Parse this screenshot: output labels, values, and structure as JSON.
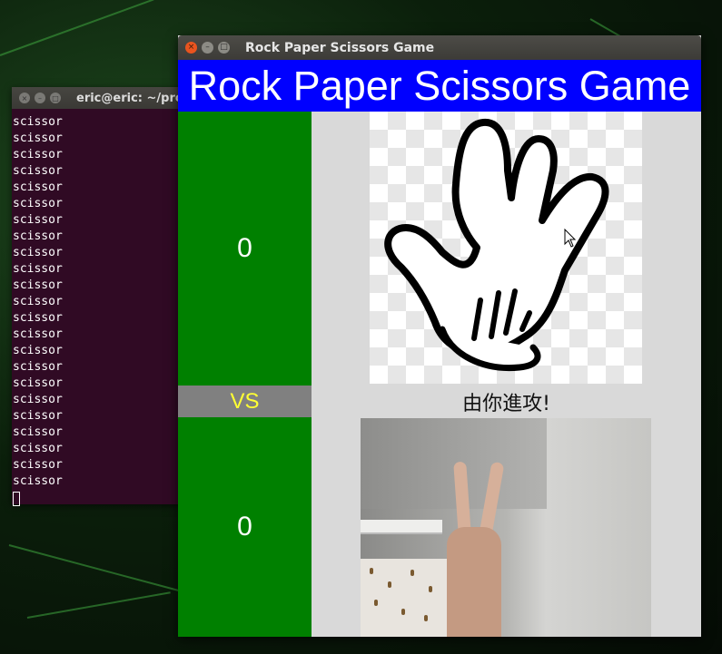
{
  "terminal": {
    "title": "eric@eric: ~/pro",
    "lines": [
      "scissor",
      "scissor",
      "scissor",
      "scissor",
      "scissor",
      "scissor",
      "scissor",
      "scissor",
      "scissor",
      "scissor",
      "scissor",
      "scissor",
      "scissor",
      "scissor",
      "scissor",
      "scissor",
      "scissor",
      "scissor",
      "scissor",
      "scissor",
      "scissor",
      "scissor",
      "scissor"
    ]
  },
  "game_window": {
    "title": "Rock Paper Scissors Game",
    "header": "Rock Paper Scissors Game",
    "computer_score": "0",
    "player_score": "0",
    "vs_label": "VS",
    "status": "由你進攻!",
    "computer_choice_icon": "paper-hand-icon"
  },
  "colors": {
    "header_bg": "#0000ff",
    "score_bg": "#008000",
    "vs_bg": "#808080",
    "vs_text": "#ffff33",
    "terminal_bg": "#300a24"
  }
}
